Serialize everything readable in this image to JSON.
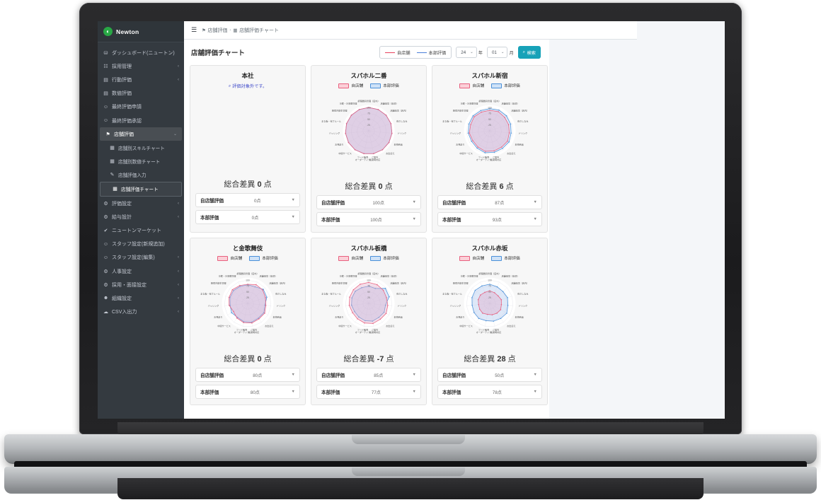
{
  "brand": {
    "name": "Newton",
    "logo_glyph": "◐"
  },
  "sidebar": {
    "items": [
      {
        "label": "ダッシュボード(ニュートン)",
        "icon": "speedometer-icon",
        "glyph": "⛁",
        "caret": ""
      },
      {
        "label": "採用管理",
        "icon": "list-icon",
        "glyph": "☷",
        "caret": "‹"
      },
      {
        "label": "行動評価",
        "icon": "id-card-icon",
        "glyph": "▤",
        "caret": "‹"
      },
      {
        "label": "数値評価",
        "icon": "id-card-icon",
        "glyph": "▤",
        "caret": ""
      },
      {
        "label": "最終評価申請",
        "icon": "user-check-icon",
        "glyph": "☺",
        "caret": ""
      },
      {
        "label": "最終評価承認",
        "icon": "user-check-icon",
        "glyph": "☺",
        "caret": ""
      },
      {
        "label": "店舗評価",
        "icon": "store-icon",
        "glyph": "⚑",
        "caret": "⌄",
        "active": true
      }
    ],
    "sub_items": [
      {
        "label": "店舗別スキルチャート",
        "icon": "chart-icon",
        "glyph": "▦"
      },
      {
        "label": "店舗別数値チャート",
        "icon": "chart-icon",
        "glyph": "▦"
      },
      {
        "label": "店舗評価入力",
        "icon": "edit-icon",
        "glyph": "✎"
      },
      {
        "label": "店舗評価チャート",
        "icon": "chart-icon",
        "glyph": "▦",
        "active": true
      }
    ],
    "items_after": [
      {
        "label": "評価設定",
        "icon": "sliders-icon",
        "glyph": "⚙",
        "caret": "‹"
      },
      {
        "label": "給与設計",
        "icon": "gear-icon",
        "glyph": "⚙",
        "caret": "‹"
      },
      {
        "label": "ニュートンマーケット",
        "icon": "check-circle-icon",
        "glyph": "✔",
        "caret": ""
      },
      {
        "label": "スタッフ設定(新規追加)",
        "icon": "user-plus-icon",
        "glyph": "☺",
        "caret": ""
      },
      {
        "label": "スタッフ設定(編集)",
        "icon": "user-edit-icon",
        "glyph": "☺",
        "caret": "‹"
      },
      {
        "label": "人事設定",
        "icon": "gear-icon",
        "glyph": "⚙",
        "caret": "‹"
      },
      {
        "label": "採用・面接設定",
        "icon": "gear-icon",
        "glyph": "⚙",
        "caret": "‹"
      },
      {
        "label": "組織設定",
        "icon": "users-icon",
        "glyph": "☻",
        "caret": "‹"
      },
      {
        "label": "CSV入出力",
        "icon": "database-icon",
        "glyph": "☁",
        "caret": "‹"
      }
    ]
  },
  "topbar": {
    "hamburger": "☰",
    "breadcrumb": [
      {
        "label": "店舗評価",
        "icon": "store-icon",
        "glyph": "⚑"
      },
      {
        "label": "店舗評価チャート",
        "icon": "chart-icon",
        "glyph": "▦"
      }
    ],
    "separator": "›"
  },
  "header": {
    "title": "店舗評価チャート",
    "legend": [
      {
        "label": "自店舗",
        "color": "#e8415c"
      },
      {
        "label": "本部評価",
        "color": "#4a7fd9"
      }
    ],
    "year_value": "24",
    "year_unit": "年",
    "month_value": "01",
    "month_unit": "月",
    "search_label": "検索",
    "search_icon": "search-icon",
    "search_icon_glyph": "⌕",
    "caret_glyph": "⌄"
  },
  "chart_legend": [
    {
      "label": "自店舗",
      "fill": "#fbd0d8",
      "stroke": "#e8607f"
    },
    {
      "label": "本部評価",
      "fill": "#cfe2f7",
      "stroke": "#4a90d9"
    }
  ],
  "radar_axes": [
    "調理器具管理（店内）",
    "店舗環境（店頭）",
    "店舗環境（店内）",
    "身だしなみ",
    "ドリンク",
    "名物商品",
    "お出迎え",
    "ご案内\n着席時対応",
    "フード販売\nオーダーテイク",
    "中間サービス",
    "お見送り",
    "バッシング",
    "まな板・包丁ルール",
    "厨房内衛生管理",
    "冷蔵・冷凍庫管理"
  ],
  "radar_ticks": [
    "100",
    "75",
    "50",
    "25"
  ],
  "score_labels": {
    "self": "自店舗評価",
    "hq": "本部評価"
  },
  "total_prefix": "総合差異",
  "total_suffix": "点",
  "score_caret": "▼",
  "cards": [
    {
      "name": "本社",
      "note": "評価対象外です。",
      "note_icon": "search-icon",
      "note_glyph": "⌕",
      "has_chart": false,
      "total": "0",
      "self_score": "0点",
      "hq_score": "0点"
    },
    {
      "name": "スパホル二番",
      "has_chart": true,
      "total": "0",
      "self_score": "100点",
      "hq_score": "100点",
      "self_values": [
        100,
        100,
        100,
        100,
        100,
        100,
        100,
        100,
        100,
        100,
        100,
        100,
        100,
        100,
        100
      ],
      "hq_values": [
        100,
        100,
        100,
        100,
        100,
        100,
        100,
        100,
        100,
        100,
        100,
        100,
        100,
        100,
        100
      ]
    },
    {
      "name": "スパホル新宿",
      "has_chart": true,
      "total": "6",
      "self_score": "87点",
      "hq_score": "93点",
      "self_values": [
        88,
        90,
        86,
        85,
        84,
        88,
        86,
        88,
        90,
        86,
        84,
        88,
        86,
        90,
        88
      ],
      "hq_values": [
        95,
        97,
        96,
        94,
        92,
        95,
        93,
        94,
        96,
        92,
        90,
        93,
        94,
        96,
        95
      ]
    },
    {
      "name": "と金歌舞伎",
      "has_chart": true,
      "total": "0",
      "self_score": "80点",
      "hq_score": "80点",
      "self_values": [
        82,
        88,
        86,
        80,
        78,
        84,
        82,
        86,
        84,
        78,
        70,
        80,
        84,
        88,
        84
      ],
      "hq_values": [
        80,
        78,
        90,
        86,
        74,
        80,
        78,
        82,
        80,
        74,
        80,
        76,
        80,
        82,
        80
      ]
    },
    {
      "name": "スパホル板橋",
      "has_chart": true,
      "total": "-7",
      "self_score": "85点",
      "hq_score": "77点",
      "self_values": [
        90,
        88,
        84,
        80,
        82,
        86,
        84,
        88,
        86,
        82,
        80,
        84,
        86,
        88,
        90
      ],
      "hq_values": [
        74,
        70,
        96,
        92,
        72,
        76,
        74,
        78,
        76,
        72,
        70,
        74,
        76,
        78,
        74
      ]
    },
    {
      "name": "スパホル赤坂",
      "has_chart": true,
      "total": "28",
      "self_score": "50点",
      "hq_score": "78点",
      "self_values": [
        54,
        50,
        48,
        52,
        50,
        54,
        52,
        50,
        48,
        52,
        50,
        48,
        52,
        54,
        52
      ],
      "hq_values": [
        82,
        78,
        76,
        80,
        78,
        84,
        80,
        78,
        76,
        80,
        78,
        76,
        80,
        84,
        82
      ]
    }
  ]
}
